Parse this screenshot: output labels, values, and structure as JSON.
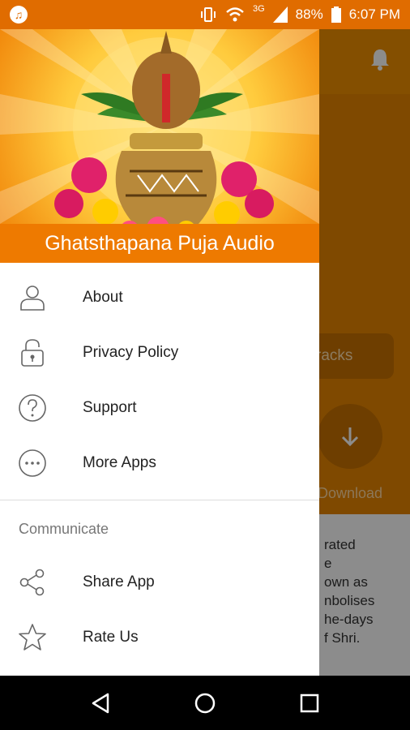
{
  "status_bar": {
    "battery": "88%",
    "time": "6:07 PM",
    "network": "3G"
  },
  "background": {
    "tracks_button": "racks",
    "download_label": "Download",
    "text_lines": [
      "rated",
      "e",
      "own as",
      "nbolises",
      "he-days",
      "f Shri."
    ]
  },
  "drawer": {
    "title": "Ghatsthapana Puja Audio",
    "items": [
      {
        "label": "About",
        "icon": "person-icon"
      },
      {
        "label": "Privacy Policy",
        "icon": "lock-icon"
      },
      {
        "label": "Support",
        "icon": "help-icon"
      },
      {
        "label": "More Apps",
        "icon": "more-icon"
      }
    ],
    "section": "Communicate",
    "communicate_items": [
      {
        "label": "Share App",
        "icon": "share-icon"
      },
      {
        "label": "Rate Us",
        "icon": "star-icon"
      }
    ]
  },
  "colors": {
    "accent": "#ee7a00",
    "status_bar": "#e06c00"
  }
}
